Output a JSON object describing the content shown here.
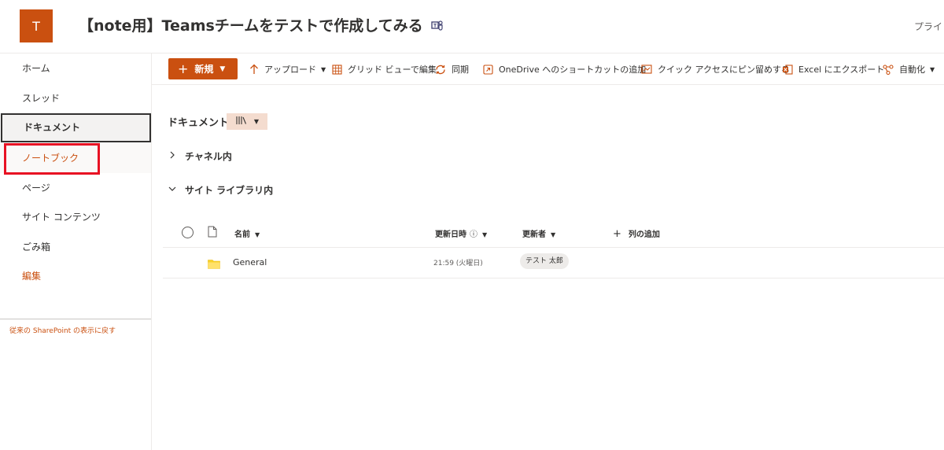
{
  "header": {
    "site_logo_letter": "T",
    "site_title": "【note用】Teamsチームをテストで作成してみる",
    "right_text": "プライ"
  },
  "leftnav": {
    "items": [
      {
        "label": "ホーム"
      },
      {
        "label": "スレッド"
      },
      {
        "label": "ドキュメント"
      },
      {
        "label": "ノートブック"
      },
      {
        "label": "ページ"
      },
      {
        "label": "サイト コンテンツ"
      },
      {
        "label": "ごみ箱"
      },
      {
        "label": "編集"
      }
    ],
    "classic_link": "従来の SharePoint の表示に戻す"
  },
  "commandbar": {
    "new_label": "新規",
    "upload_label": "アップロード",
    "grid_label": "グリッド ビューで編集",
    "sync_label": "同期",
    "onedrive_label": "OneDrive へのショートカットの追加",
    "pin_label": "クイック アクセスにピン留めする",
    "excel_label": "Excel にエクスポート",
    "automate_label": "自動化"
  },
  "library": {
    "title": "ドキュメント",
    "groups": [
      {
        "label": "チャネル内",
        "expanded": false
      },
      {
        "label": "サイト ライブラリ内",
        "expanded": true
      }
    ],
    "columns": {
      "name": "名前",
      "modified": "更新日時",
      "modified_by": "更新者",
      "add_column": "列の追加"
    },
    "rows": [
      {
        "name": "General",
        "modified": "21:59 (火曜日)",
        "modified_by": "テスト 太郎"
      }
    ]
  },
  "colors": {
    "accent": "#ca5010",
    "highlight_box": "#e81123"
  }
}
